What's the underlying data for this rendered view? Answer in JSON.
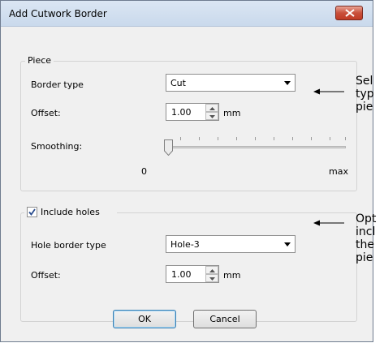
{
  "window": {
    "title": "Add Cutwork Border"
  },
  "piece": {
    "legend": "Piece",
    "border_type_label": "Border type",
    "border_type_value": "Cut",
    "offset_label": "Offset:",
    "offset_value": "1.00",
    "offset_unit": "mm",
    "smoothing_label": "Smoothing:",
    "smoothing_min": "0",
    "smoothing_max": "max",
    "smoothing_level": 0
  },
  "holes": {
    "include_label": "Include holes",
    "include_checked": true,
    "hole_border_type_label": "Hole border type",
    "hole_border_type_value": "Hole-3",
    "offset_label": "Offset:",
    "offset_value": "1.00",
    "offset_unit": "mm"
  },
  "buttons": {
    "ok": "OK",
    "cancel": "Cancel"
  },
  "callouts": {
    "first": [
      "Sel",
      "typ",
      "pie"
    ],
    "second": [
      "Opt",
      "incl",
      "the",
      "pie"
    ]
  },
  "colors": {
    "close_button": "#c9503b",
    "accent_focus": "#3c7fb1"
  },
  "icons": [
    "close-icon",
    "dropdown-arrow-icon",
    "spin-up-icon",
    "spin-down-icon",
    "checkmark-icon",
    "arrow-left-icon"
  ]
}
